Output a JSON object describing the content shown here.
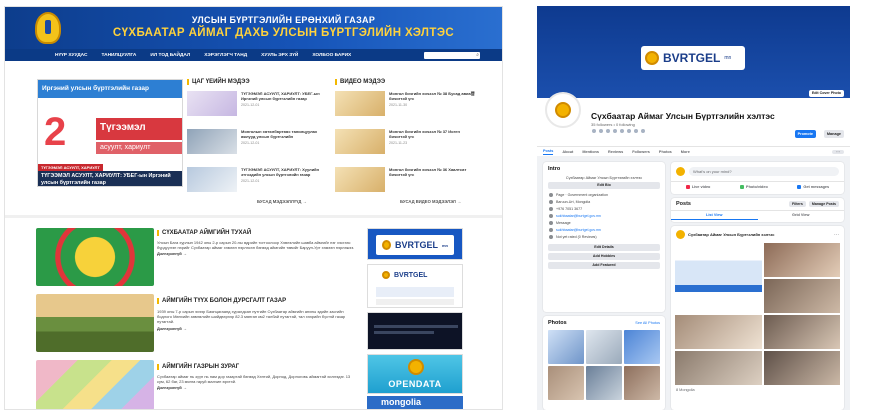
{
  "website": {
    "banner": {
      "line1": "УЛСЫН БҮРТГЭЛИЙН ЕРӨНХИЙ ГАЗАР",
      "line2": "СҮХБААТАР АЙМАГ ДАХЬ УЛСЫН БҮРТГЭЛИЙН ХЭЛТЭС"
    },
    "nav": [
      "НҮҮР ХУУДАС",
      "ТАНИЛЦУУЛГА",
      "ИЛ ТОД БАЙДАЛ",
      "ХЭРЭГЛЭГЧ ТАНД",
      "ХУУЛЬ ЭРХ ЗҮЙ",
      "ХОЛБОО БАРИХ"
    ],
    "search_placeholder": "Хайх...",
    "feature": {
      "head": "Иргэний улсын бүртгэлийн газар",
      "big_num": "2",
      "qa_title": "Түгээмэл",
      "qa_sub": "асуулт, хариулт",
      "tag": "ТҮГЭЭМЭЛ АСУУЛТ, ХАРИУЛТ",
      "caption": "ТҮГЭЭМЭЛ АСУУЛТ, ХАРИУЛТ: УБЕГ-ын Иргэний улсын бүртгэлийн газар"
    },
    "news_title": "ЦАГ ҮЕИЙН МЭДЭЭ",
    "video_title": "ВИДЕО МЭДЭЭ",
    "news": [
      {
        "text": "ТҮГЭЭМЭЛ АСУУЛТ, ХАРИУЛТ: УБЕГ-ын Иргэний улсын бүртгэлийн газар",
        "date": "2021-12-01"
      },
      {
        "text": "Монголын хөтөлбөртөөс танилцуулах ажлууд улсын бүртгэлийн",
        "date": "2021-12-01"
      },
      {
        "text": "ТҮГЭЭМЭЛ АСУУЛТ, ХАРИУЛТ: Хуулийн этгээдийн улсын бүртгэлийн газар",
        "date": "2021-12-01"
      }
    ],
    "videos": [
      {
        "text": "Монгол бичгийн хичээл № 38 Бусад авиа营 бичигтэй үгс",
        "date": "2021-11-30"
      },
      {
        "text": "Монгол бичгийн хичээл № 37 Иоген бичигтэй үгс",
        "date": "2021-11-23"
      },
      {
        "text": "Монгол бичгийн хичээл № 36 Хаалтсат бичигтэй үгс",
        "date": ""
      }
    ],
    "more_news": "БУСАД МЭДЭЭЛЛҮҮД →",
    "more_videos": "БУСАД ВИДЕО МЭДЭЭЛЭЛ →",
    "sections": [
      {
        "title": "СҮХБААТАР АЙМГИЙН ТУХАЙ",
        "text": "Улсын Бага хурлын 1942 оны 2-р сарын 20-ны өдрийн тогтоолоор Хэвлэлийн шавба аймгийг нэг хэсгээс бүрдүүлэн нэрийг Сүхбаатар аймаг хэмээн нэрлэсэн бөгөөд аймгийн төвийг Баруун-Урт хэмээн нэрлэжээ.",
        "link": "Дэлгэрэнгүй →"
      },
      {
        "title": "АЙМГИЙН ТҮҮХ БОЛОН ДУРСГАЛТ ГАЗАР",
        "text": "1939 оны 7-р сарын эхээр Баянцагаанд хуралдсан нутгийн Сүхбаатар аймгийн анхны эдийн засгийн бодлого Мөнхийн зөвлөлийн шийдвэрээр 82.3 мянган км2 талбай нутагтай, тал хээрийн бүстэй газар нутагтай.",
        "link": "Дэлгэрэнгүй →"
      },
      {
        "title": "АЙМГИЙН ГАЗРЫН ЗУРАГ",
        "text": "Сүхбаатар аймаг нь зүүн нь нам дор газартай бөгөөд Хэнтий, Дорнод, Дорноговь аймагтай хиллэдэг. 13 сум, 62 баг, 23 мянга гаруй малчин өрхтэй.",
        "link": "Дэлгэрэнгүй →"
      }
    ],
    "ads": {
      "bvrtgel": "BVRTGEL",
      "mn": "mn",
      "opendata": "OPENDATA",
      "mongolia": "mongolia"
    }
  },
  "facebook": {
    "cover_logo": "BVRTGEL",
    "cover_logo_mn": "mn",
    "edit_cover": "Edit Cover Photo",
    "page_name": "Сүхбаатар Аймаг Улсын Бүртгэлийн хэлтэс",
    "followers": "35 followers • 0 following",
    "btn_promote": "Promote",
    "btn_manage": "Manage",
    "tabs": [
      "Posts",
      "About",
      "Mentions",
      "Reviews",
      "Followers",
      "Photos",
      "More"
    ],
    "intro": {
      "title": "Intro",
      "desc": "Сүхбаатар Аймаг Улсын Бүртгэлийн хэлтэс",
      "edit_bio": "Edit Bio",
      "rows": [
        "Page · Government organization",
        "Baruun-Urt, Mongolia",
        "+976 7051 3677",
        "sukhbaatar@burtgel.gov.mn",
        "Message",
        "sukhbaatar@burtgel.gov.mn",
        "Not yet rated (0 Reviews)"
      ],
      "btn_details": "Edit Details",
      "btn_hobbies": "Add Hobbies",
      "btn_featured": "Add Featured"
    },
    "photos": {
      "title": "Photos",
      "see_all": "See All Photos"
    },
    "composer": {
      "placeholder": "What's on your mind?",
      "live": "Live video",
      "photo": "Photo/video",
      "msg": "Get messages"
    },
    "posts": {
      "title": "Posts",
      "filters": "Filters",
      "manage": "Manage Posts",
      "list_view": "List View",
      "grid_view": "Grid View",
      "author": "Сүхбаатар Аймаг Улсын Бүртгэлийн хэлтэс",
      "reactions": "8 Mongolia"
    }
  }
}
